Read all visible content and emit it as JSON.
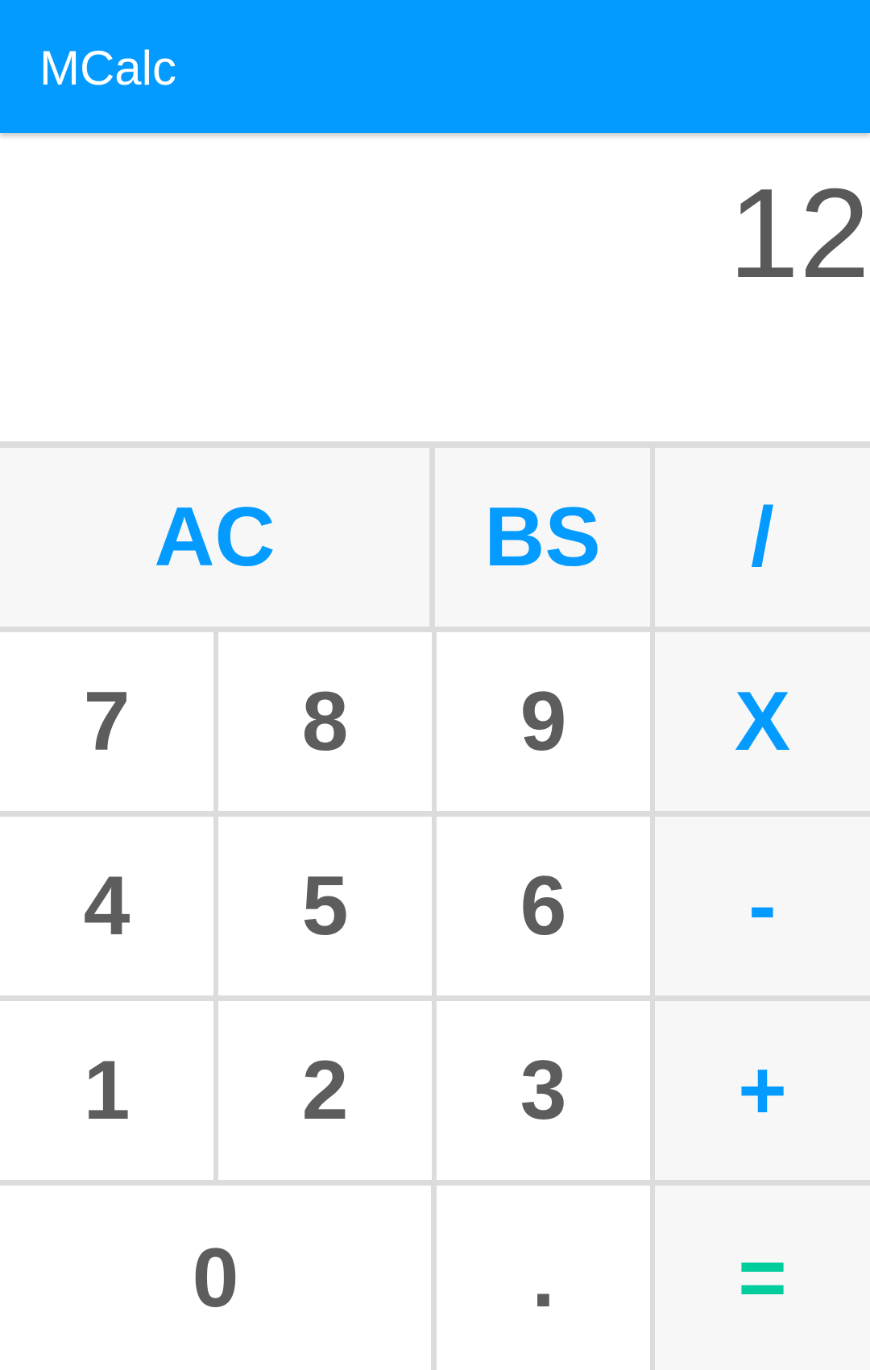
{
  "app": {
    "title": "MCalc"
  },
  "display": {
    "value": "12"
  },
  "keys": {
    "ac": "AC",
    "bs": "BS",
    "divide": "/",
    "seven": "7",
    "eight": "8",
    "nine": "9",
    "multiply": "X",
    "four": "4",
    "five": "5",
    "six": "6",
    "minus": "-",
    "one": "1",
    "two": "2",
    "three": "3",
    "plus": "+",
    "zero": "0",
    "dot": ".",
    "equals": "="
  },
  "colors": {
    "appbar": "#039bff",
    "accent": "#039bff",
    "digit_text": "#5d5d5d",
    "equals": "#00cd9c",
    "function_key_bg": "#f7f7f7",
    "digit_key_bg": "#ffffff"
  }
}
